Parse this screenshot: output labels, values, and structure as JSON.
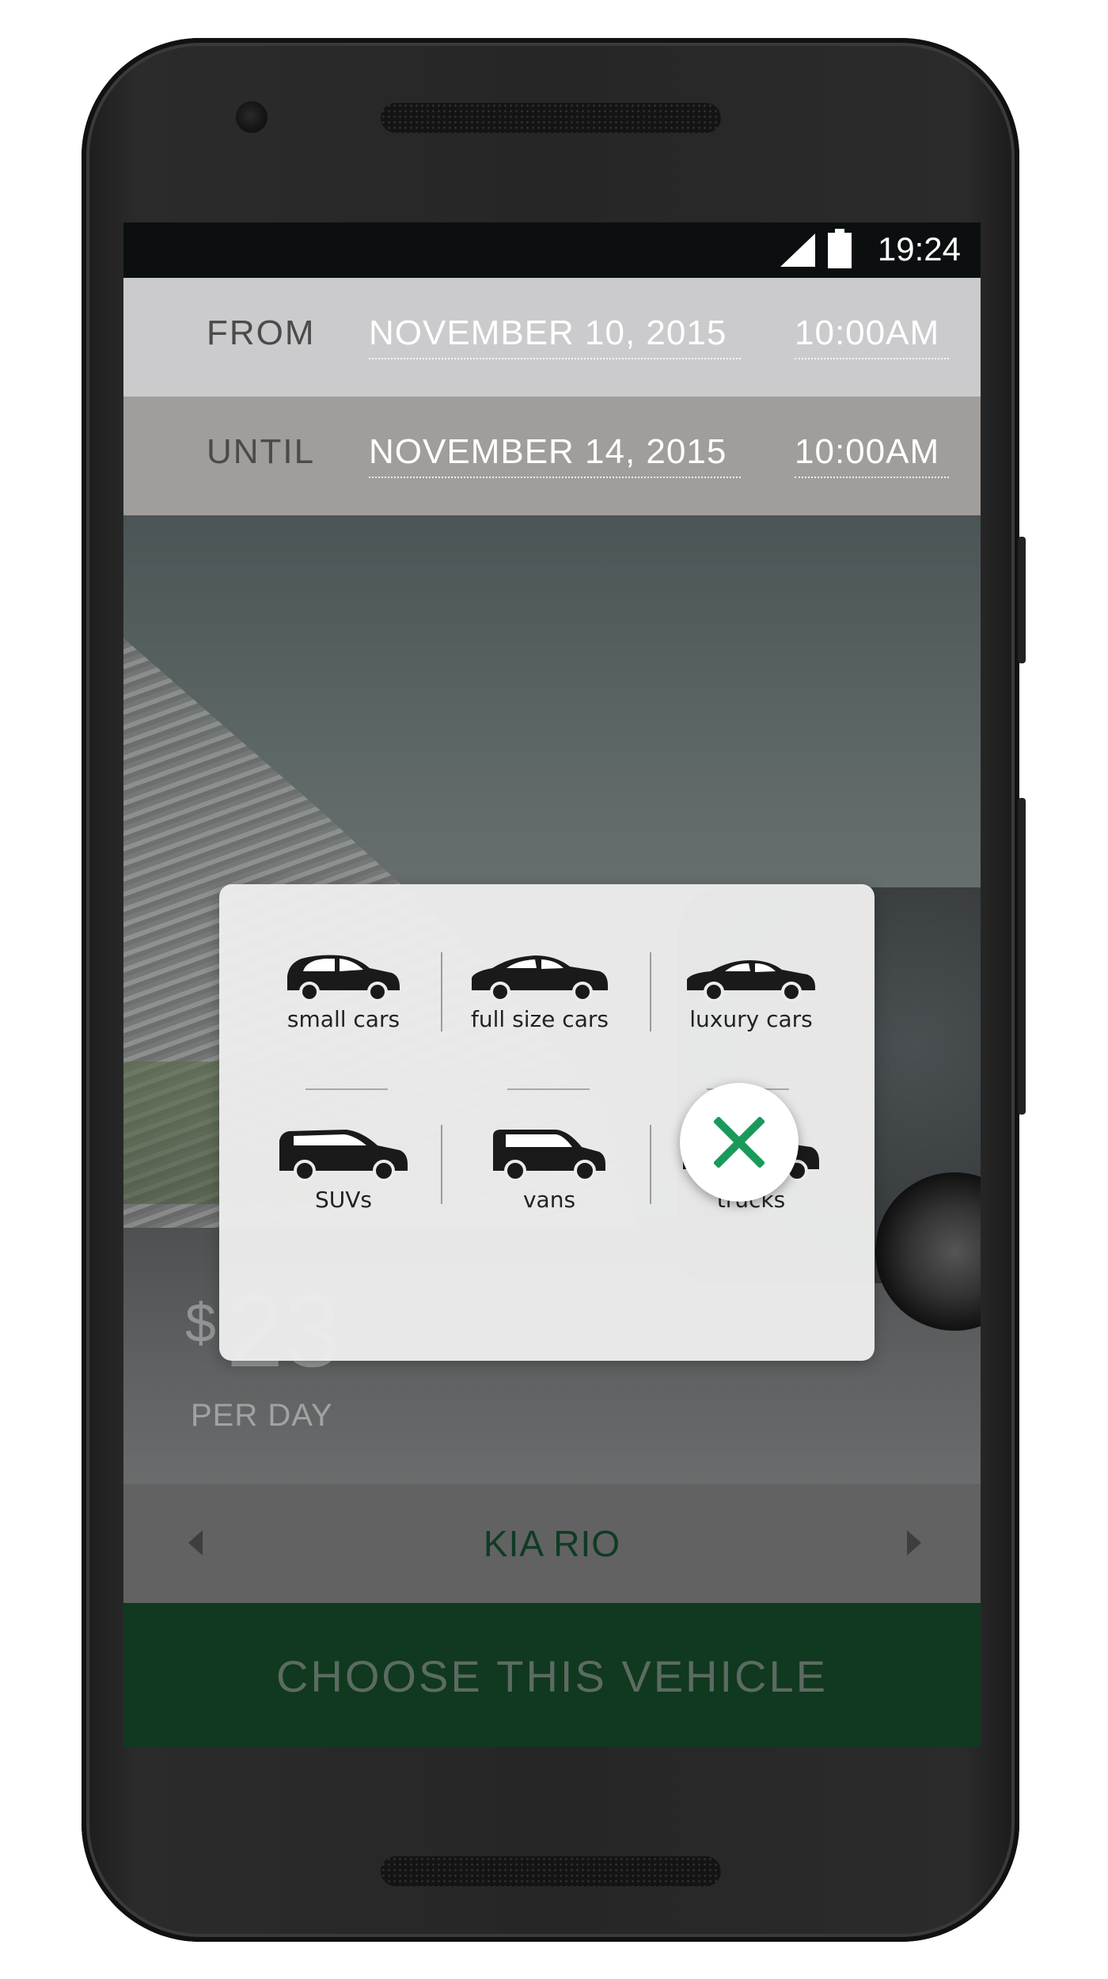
{
  "status_bar": {
    "time": "19:24",
    "signal_icon": "signal-icon",
    "battery_icon": "battery-icon"
  },
  "booking": {
    "from": {
      "label": "FROM",
      "date": "NOVEMBER 10, 2015",
      "time": "10:00AM"
    },
    "until": {
      "label": "UNTIL",
      "date": "NOVEMBER 14, 2015",
      "time": "10:00AM"
    }
  },
  "price": {
    "currency": "$",
    "amount": "23",
    "unit": "PER DAY"
  },
  "vehicle": {
    "name": "KIA RIO",
    "prev_icon": "chevron-left-icon",
    "next_icon": "chevron-right-icon"
  },
  "cta": {
    "label": "CHOOSE THIS VEHICLE"
  },
  "categories": [
    {
      "label": "small cars",
      "icon": "small-car-icon"
    },
    {
      "label": "full size cars",
      "icon": "sedan-icon"
    },
    {
      "label": "luxury cars",
      "icon": "luxury-car-icon"
    },
    {
      "label": "SUVs",
      "icon": "suv-icon"
    },
    {
      "label": "vans",
      "icon": "van-icon"
    },
    {
      "label": "trucks",
      "icon": "truck-icon"
    }
  ],
  "close_icon": "close-icon",
  "colors": {
    "accent": "#1a9a5a",
    "cta_bg": "#10391f",
    "from_bg": "#cbcbcd",
    "until_bg": "#a09d9a"
  }
}
